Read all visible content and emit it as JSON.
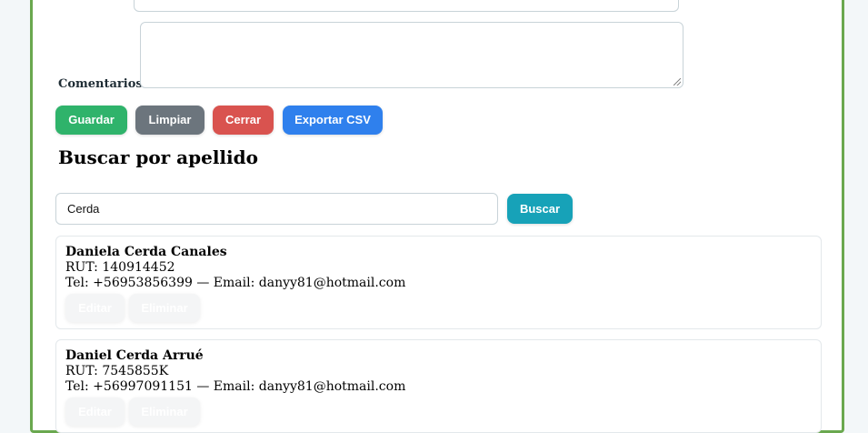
{
  "form": {
    "comments_label": "Comentarios:",
    "comments_value": "",
    "buttons": {
      "save": "Guardar",
      "clear": "Limpiar",
      "close": "Cerrar",
      "export": "Exportar CSV"
    }
  },
  "search": {
    "title": "Buscar por apellido",
    "value": "Cerda",
    "button": "Buscar"
  },
  "results": [
    {
      "name": "Daniela Cerda Canales",
      "rut": "RUT: 140914452",
      "contact": "Tel: +56953856399 — Email: danyy81@hotmail.com",
      "edit": "Editar",
      "delete": "Eliminar"
    },
    {
      "name": "Daniel Cerda Arrué",
      "rut": "RUT: 7545855K",
      "contact": "Tel: +56997091151 — Email: danyy81@hotmail.com",
      "edit": "Editar",
      "delete": "Eliminar"
    }
  ],
  "colors": {
    "frame_border": "#6aa84f",
    "save": "#2fb36b",
    "clear": "#6c757d",
    "close": "#d9534f",
    "export": "#2f80ed",
    "search": "#17a2b8"
  }
}
